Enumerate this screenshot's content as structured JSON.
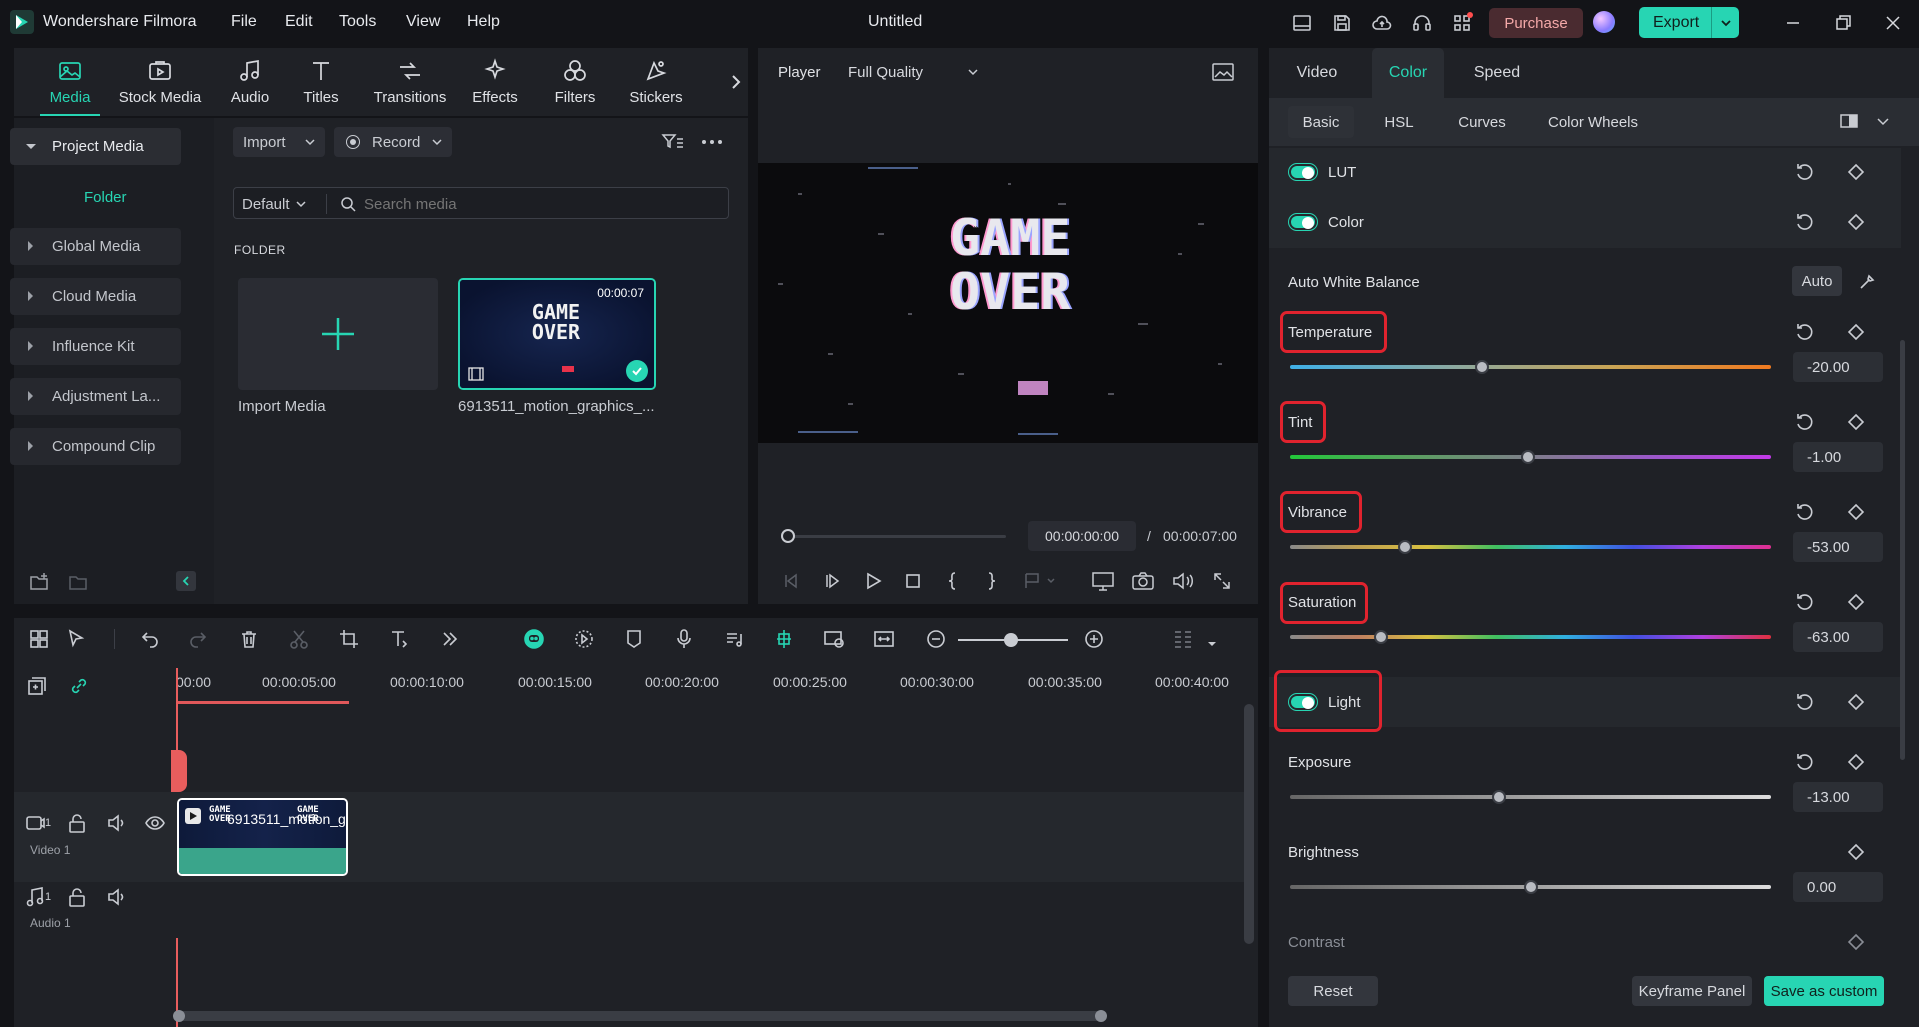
{
  "titlebar": {
    "app_name": "Wondershare Filmora",
    "menu": [
      "File",
      "Edit",
      "Tools",
      "View",
      "Help"
    ],
    "document_title": "Untitled",
    "purchase_label": "Purchase",
    "export_label": "Export"
  },
  "media_tabs": [
    "Media",
    "Stock Media",
    "Audio",
    "Titles",
    "Transitions",
    "Effects",
    "Filters",
    "Stickers"
  ],
  "sidebar": {
    "project_media": "Project Media",
    "folder": "Folder",
    "items": [
      "Global Media",
      "Cloud Media",
      "Influence Kit",
      "Adjustment La...",
      "Compound Clip"
    ]
  },
  "media": {
    "import_label": "Import",
    "record_label": "Record",
    "sort_label": "Default",
    "search_placeholder": "Search media",
    "folder_heading": "FOLDER",
    "import_tile_label": "Import Media",
    "clip_name": "6913511_motion_graphics_...",
    "clip_duration": "00:00:07",
    "thumb_text": "GAME OVER"
  },
  "player": {
    "label": "Player",
    "quality": "Full Quality",
    "video_text_line1": "GAME",
    "video_text_line2": "OVER",
    "current_time": "00:00:00:00",
    "separator": "/",
    "total_time": "00:00:07:00",
    "progress": 0
  },
  "properties": {
    "tabs": [
      "Video",
      "Color",
      "Speed"
    ],
    "active_tab": "Color",
    "subtabs": [
      "Basic",
      "HSL",
      "Curves",
      "Color Wheels"
    ],
    "active_subtab": "Basic",
    "lut_label": "LUT",
    "color_label": "Color",
    "awb_label": "Auto White Balance",
    "auto_label": "Auto",
    "sliders": [
      {
        "label": "Temperature",
        "value": "-20.00",
        "fraction": 0.4
      },
      {
        "label": "Tint",
        "value": "-1.00",
        "fraction": 0.495
      },
      {
        "label": "Vibrance",
        "value": "-53.00",
        "fraction": 0.24
      },
      {
        "label": "Saturation",
        "value": "-63.00",
        "fraction": 0.19
      }
    ],
    "light_label": "Light",
    "light_sliders": [
      {
        "label": "Exposure",
        "value": "-13.00",
        "fraction": 0.435
      },
      {
        "label": "Brightness",
        "value": "0.00",
        "fraction": 0.5
      }
    ],
    "contrast_label": "Contrast",
    "reset_label": "Reset",
    "keyframe_label": "Keyframe Panel",
    "save_custom_label": "Save as custom",
    "colors": {
      "accent": "#27d5b3",
      "highlight": "#e0232e"
    }
  },
  "timeline": {
    "ruler_ticks": [
      "00:00",
      "00:00:05:00",
      "00:00:10:00",
      "00:00:15:00",
      "00:00:20:00",
      "00:00:25:00",
      "00:00:30:00",
      "00:00:35:00",
      "00:00:40:00"
    ],
    "video_track": "Video 1",
    "video_track_num": "1",
    "audio_track": "Audio 1",
    "audio_track_num": "1",
    "clip_label": "6913511_motion_g..."
  }
}
